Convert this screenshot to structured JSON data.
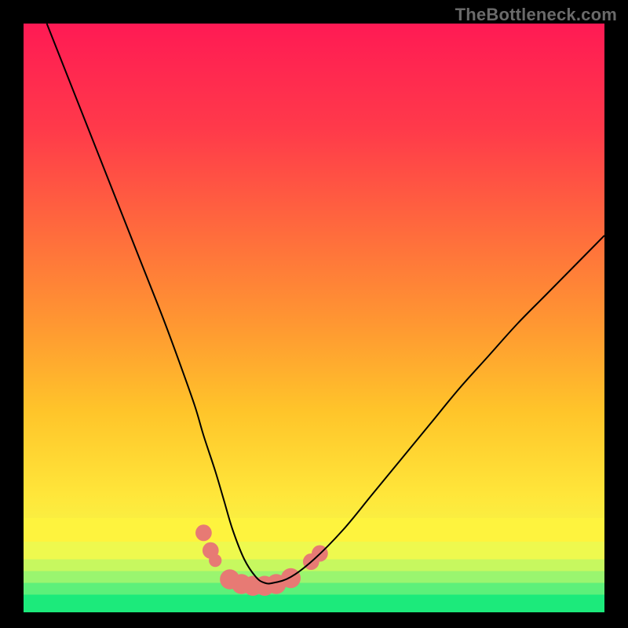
{
  "watermark": "TheBottleneck.com",
  "chart_data": {
    "type": "line",
    "title": "",
    "xlabel": "",
    "ylabel": "",
    "xlim": [
      0,
      100
    ],
    "ylim": [
      0,
      100
    ],
    "series": [
      {
        "name": "bottleneck-curve",
        "x": [
          4,
          8,
          12,
          16,
          20,
          24,
          27,
          29.5,
          31,
          33,
          34.5,
          36,
          38,
          40,
          41.5,
          43,
          46,
          50,
          55,
          60,
          65,
          70,
          75,
          80,
          85,
          90,
          96,
          100
        ],
        "y": [
          100,
          90,
          80,
          70,
          60,
          50,
          42,
          35,
          30,
          24,
          19,
          14,
          9,
          6,
          5,
          5,
          6,
          9,
          14,
          20,
          26,
          32,
          38,
          43.5,
          49,
          54,
          60,
          64
        ]
      }
    ],
    "markers": {
      "name": "highlight-points",
      "color": "#e77a74",
      "points": [
        {
          "x": 31.0,
          "y": 13.5,
          "r": 1.4
        },
        {
          "x": 32.2,
          "y": 10.5,
          "r": 1.4
        },
        {
          "x": 33.0,
          "y": 8.8,
          "r": 1.1
        },
        {
          "x": 35.5,
          "y": 5.6,
          "r": 1.7
        },
        {
          "x": 37.5,
          "y": 4.8,
          "r": 1.7
        },
        {
          "x": 39.5,
          "y": 4.5,
          "r": 1.7
        },
        {
          "x": 41.5,
          "y": 4.5,
          "r": 1.7
        },
        {
          "x": 43.5,
          "y": 4.8,
          "r": 1.7
        },
        {
          "x": 46.0,
          "y": 5.8,
          "r": 1.7
        },
        {
          "x": 49.5,
          "y": 8.6,
          "r": 1.4
        },
        {
          "x": 51.0,
          "y": 10.0,
          "r": 1.4
        }
      ]
    },
    "bands": [
      {
        "y0": 0,
        "y1": 3,
        "color": "#1cea7b"
      },
      {
        "y0": 3,
        "y1": 5,
        "color": "#5df07a"
      },
      {
        "y0": 5,
        "y1": 7,
        "color": "#9af56f"
      },
      {
        "y0": 7,
        "y1": 9,
        "color": "#c7f85f"
      },
      {
        "y0": 9,
        "y1": 12,
        "color": "#eef94e"
      },
      {
        "y0": 12,
        "y1": 16,
        "color": "#fef33e"
      }
    ],
    "gradient_stops": [
      {
        "offset": 0.0,
        "color": "#ff1a54"
      },
      {
        "offset": 0.18,
        "color": "#ff3a4a"
      },
      {
        "offset": 0.35,
        "color": "#ff6a3d"
      },
      {
        "offset": 0.52,
        "color": "#ff9a31"
      },
      {
        "offset": 0.66,
        "color": "#ffc52a"
      },
      {
        "offset": 0.8,
        "color": "#ffe63a"
      },
      {
        "offset": 0.9,
        "color": "#f4f94a"
      },
      {
        "offset": 1.0,
        "color": "#e6fb55"
      }
    ]
  }
}
